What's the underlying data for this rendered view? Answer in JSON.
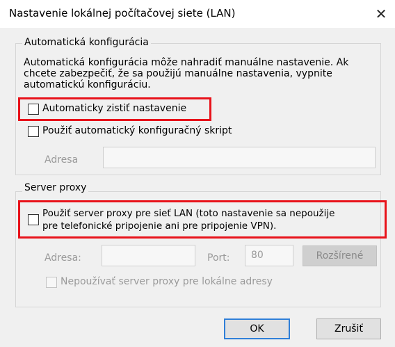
{
  "window": {
    "title": "Nastavenie lokálnej počítačovej siete (LAN)",
    "close_glyph": "✕"
  },
  "auto_config": {
    "legend": "Automatická konfigurácia",
    "description": "Automatická konfigurácia môže nahradiť manuálne nastavenie. Ak chcete zabezpečiť, že sa použijú manuálne nastavenia, vypnite automatickú konfiguráciu.",
    "auto_detect_label": "Automaticky zistiť nastavenie",
    "auto_detect_checked": false,
    "use_script_label": "Použiť automatický konfiguračný skript",
    "use_script_checked": false,
    "address_label": "Adresa",
    "address_value": ""
  },
  "proxy": {
    "legend": "Server proxy",
    "use_proxy_label_line1": "Použiť server proxy pre sieť LAN (toto nastavenie sa nepoužije",
    "use_proxy_label_line2": "pre telefonické pripojenie ani pre pripojenie VPN).",
    "use_proxy_checked": false,
    "address_label": "Adresa:",
    "address_value": "",
    "port_label": "Port:",
    "port_value": "80",
    "advanced_label": "Rozšírené",
    "bypass_label": "Nepoužívať server proxy pre lokálne adresy",
    "bypass_checked": false
  },
  "buttons": {
    "ok_label": "OK",
    "cancel_label": "Zrušiť"
  },
  "colors": {
    "highlight": "#e8121a",
    "default_button_border": "#2f7fd8"
  }
}
